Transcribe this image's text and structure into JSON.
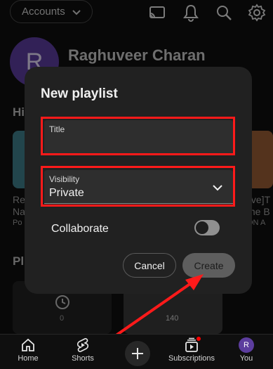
{
  "topbar": {
    "accounts_label": "Accounts",
    "icons": [
      "cast-icon",
      "bell-icon",
      "search-icon",
      "gear-icon"
    ]
  },
  "profile": {
    "initial": "R",
    "name": "Raghuveer Charan"
  },
  "background": {
    "history_heading_partial": "Hi",
    "left_card_line1": "Re",
    "left_card_line2": "Na",
    "left_card_line3": "Po",
    "right_card_line1": "Live]T",
    "right_card_line2": "tne B",
    "right_card_line3": "ON A",
    "playlists_heading_partial": "Pl",
    "card1_count": "0",
    "card2_count": "140"
  },
  "dialog": {
    "title": "New playlist",
    "title_field": {
      "label": "Title",
      "value": ""
    },
    "visibility_field": {
      "label": "Visibility",
      "value": "Private"
    },
    "collaborate_label": "Collaborate",
    "collaborate_on": false,
    "cancel_label": "Cancel",
    "create_label": "Create"
  },
  "bottom_nav": {
    "home": "Home",
    "shorts": "Shorts",
    "subscriptions": "Subscriptions",
    "you": "You",
    "you_initial": "R"
  },
  "colors": {
    "highlight": "#ff1a1a",
    "avatar": "#5c3d9e",
    "dialog_bg": "#212121"
  }
}
